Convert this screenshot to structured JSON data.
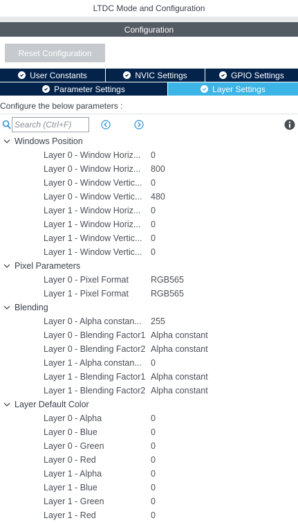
{
  "window": {
    "title": "LTDC Mode and Configuration"
  },
  "config_header": "Configuration",
  "reset_button": "Reset Configuration",
  "tabs_row1": [
    {
      "label": "User Constants",
      "active": false
    },
    {
      "label": "NVIC Settings",
      "active": false
    },
    {
      "label": "GPIO Settings",
      "active": false
    }
  ],
  "tabs_row2": [
    {
      "label": "Parameter Settings",
      "active": false
    },
    {
      "label": "Layer Settings",
      "active": true
    }
  ],
  "configure_text": "Configure the below parameters :",
  "search": {
    "placeholder": "Search (Ctrl+F)"
  },
  "colors": {
    "dark_tab": "#03234b",
    "active_tab": "#3cb4e6",
    "header": "#555b63",
    "button": "#c6cace"
  },
  "groups": [
    {
      "label": "Windows Position",
      "params": [
        {
          "name": "Layer 0 - Window Horiz...",
          "value": "0"
        },
        {
          "name": "Layer 0 - Window Horiz...",
          "value": "800"
        },
        {
          "name": "Layer 0 - Window Vertic...",
          "value": "0"
        },
        {
          "name": "Layer 0 - Window Vertic...",
          "value": "480"
        },
        {
          "name": "Layer 1 - Window Horiz...",
          "value": "0"
        },
        {
          "name": "Layer 1 - Window Horiz...",
          "value": "0"
        },
        {
          "name": "Layer 1 - Window Vertic...",
          "value": "0"
        },
        {
          "name": "Layer 1 - Window Vertic...",
          "value": "0"
        }
      ]
    },
    {
      "label": "Pixel Parameters",
      "params": [
        {
          "name": "Layer 0 - Pixel Format",
          "value": "RGB565"
        },
        {
          "name": "Layer 1 - Pixel Format",
          "value": "RGB565"
        }
      ]
    },
    {
      "label": "Blending",
      "params": [
        {
          "name": "Layer 0 - Alpha constan...",
          "value": "255"
        },
        {
          "name": "Layer 0 - Blending Factor1",
          "value": "Alpha constant"
        },
        {
          "name": "Layer 0 - Blending Factor2",
          "value": "Alpha constant"
        },
        {
          "name": "Layer 1 - Alpha constan...",
          "value": "0"
        },
        {
          "name": "Layer 1 - Blending Factor1",
          "value": "Alpha constant"
        },
        {
          "name": "Layer 1 - Blending Factor2",
          "value": "Alpha constant"
        }
      ]
    },
    {
      "label": "Layer Default Color",
      "params": [
        {
          "name": "Layer 0 - Alpha",
          "value": "0"
        },
        {
          "name": "Layer 0 - Blue",
          "value": "0"
        },
        {
          "name": "Layer 0 - Green",
          "value": "0"
        },
        {
          "name": "Layer 0 - Red",
          "value": "0"
        },
        {
          "name": "Layer 1 - Alpha",
          "value": "0"
        },
        {
          "name": "Layer 1 - Blue",
          "value": "0"
        },
        {
          "name": "Layer 1 - Green",
          "value": "0"
        },
        {
          "name": "Layer 1 - Red",
          "value": "0"
        }
      ]
    }
  ]
}
